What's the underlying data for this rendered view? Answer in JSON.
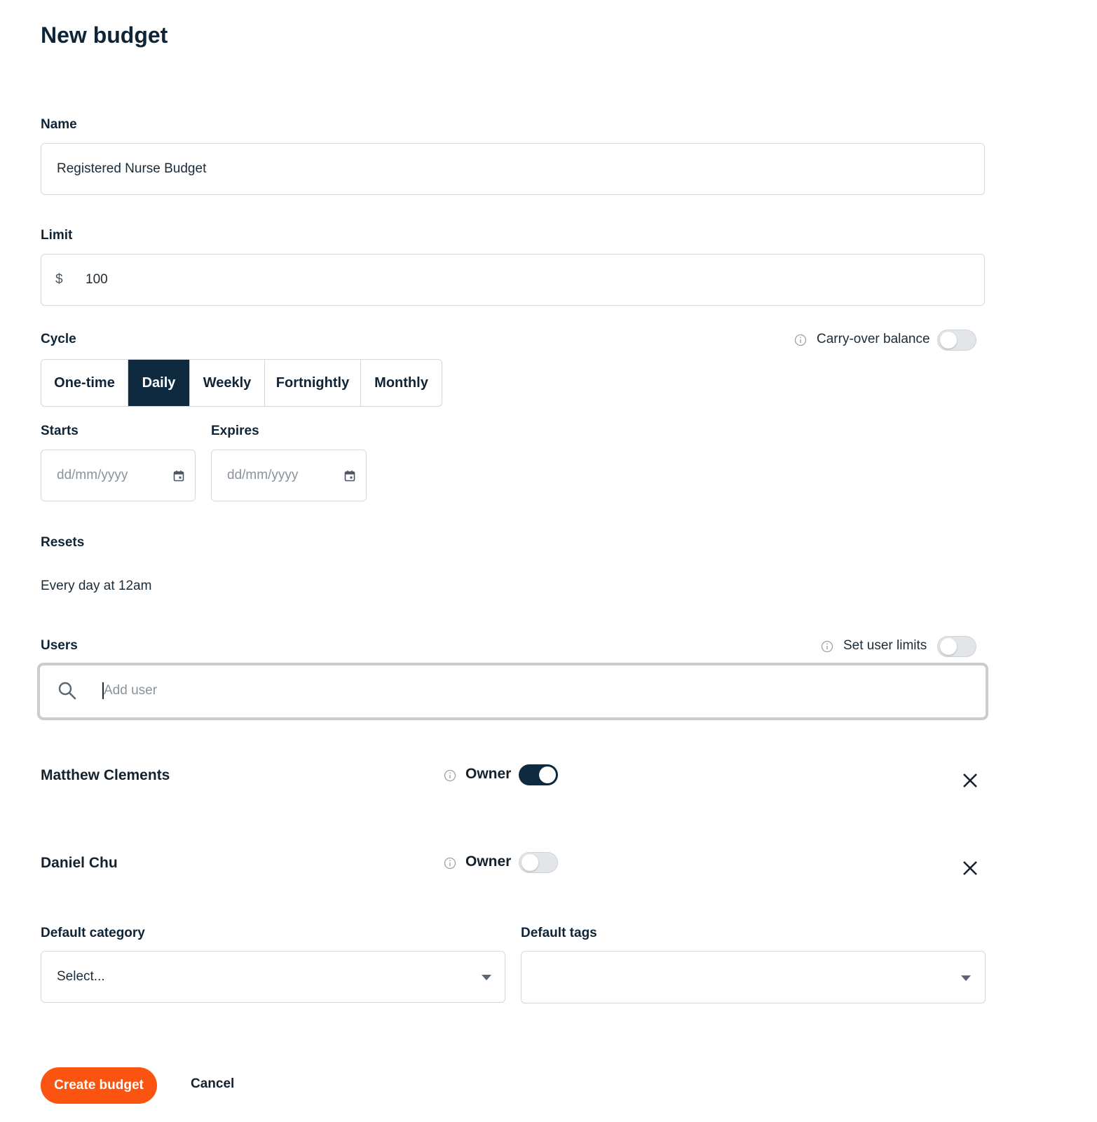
{
  "page": {
    "title": "New budget"
  },
  "name": {
    "label": "Name",
    "value": "Registered Nurse Budget"
  },
  "limit": {
    "label": "Limit",
    "currency": "$",
    "value": "100"
  },
  "cycle": {
    "label": "Cycle",
    "options": [
      "One-time",
      "Daily",
      "Weekly",
      "Fortnightly",
      "Monthly"
    ],
    "selected": "Daily",
    "carry_over_label": "Carry-over balance",
    "carry_over_enabled": false
  },
  "starts": {
    "label": "Starts",
    "placeholder": "dd/mm/yyyy"
  },
  "expires": {
    "label": "Expires",
    "placeholder": "dd/mm/yyyy"
  },
  "resets": {
    "label": "Resets",
    "value": "Every day at 12am"
  },
  "users": {
    "label": "Users",
    "set_limits_label": "Set user limits",
    "set_limits_enabled": false,
    "search_placeholder": "Add user",
    "list": [
      {
        "name": "Matthew Clements",
        "owner_label": "Owner",
        "owner": true
      },
      {
        "name": "Daniel Chu",
        "owner_label": "Owner",
        "owner": false
      }
    ]
  },
  "default_category": {
    "label": "Default category",
    "value": "Select..."
  },
  "default_tags": {
    "label": "Default tags",
    "value": ""
  },
  "actions": {
    "create_label": "Create budget",
    "cancel_label": "Cancel"
  },
  "colors": {
    "primary": "#0e2a3f",
    "accent": "#fa5410",
    "border": "#d4d8dd"
  },
  "icons": [
    "info-icon",
    "calendar-icon",
    "search-icon",
    "close-icon",
    "caret-down-icon"
  ]
}
